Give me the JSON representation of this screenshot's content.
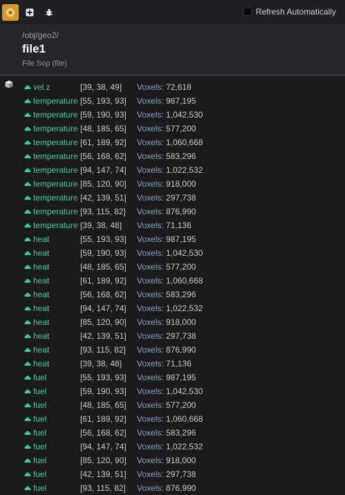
{
  "toolbar": {
    "refresh_label": "Refresh Automatically",
    "accent": "#d39a2f"
  },
  "header": {
    "path": "/obj/geo2/",
    "title": "file1",
    "subtitle": "File Sop (file)"
  },
  "volume_label": "Voxels:",
  "volumes": [
    {
      "name": "vel.z",
      "res": "[39, 38, 49]",
      "voxels": "72,618"
    },
    {
      "name": "temperature",
      "res": "[55, 193, 93]",
      "voxels": "987,195"
    },
    {
      "name": "temperature",
      "res": "[59, 190, 93]",
      "voxels": "1,042,530"
    },
    {
      "name": "temperature",
      "res": "[48, 185, 65]",
      "voxels": "577,200"
    },
    {
      "name": "temperature",
      "res": "[61, 189, 92]",
      "voxels": "1,060,668"
    },
    {
      "name": "temperature",
      "res": "[56, 168, 62]",
      "voxels": "583,296"
    },
    {
      "name": "temperature",
      "res": "[94, 147, 74]",
      "voxels": "1,022,532"
    },
    {
      "name": "temperature",
      "res": "[85, 120, 90]",
      "voxels": "918,000"
    },
    {
      "name": "temperature",
      "res": "[42, 139, 51]",
      "voxels": "297,738"
    },
    {
      "name": "temperature",
      "res": "[93, 115, 82]",
      "voxels": "876,990"
    },
    {
      "name": "temperature",
      "res": "[39, 38, 48]",
      "voxels": "71,136"
    },
    {
      "name": "heat",
      "res": "[55, 193, 93]",
      "voxels": "987,195"
    },
    {
      "name": "heat",
      "res": "[59, 190, 93]",
      "voxels": "1,042,530"
    },
    {
      "name": "heat",
      "res": "[48, 185, 65]",
      "voxels": "577,200"
    },
    {
      "name": "heat",
      "res": "[61, 189, 92]",
      "voxels": "1,060,668"
    },
    {
      "name": "heat",
      "res": "[56, 168, 62]",
      "voxels": "583,296"
    },
    {
      "name": "heat",
      "res": "[94, 147, 74]",
      "voxels": "1,022,532"
    },
    {
      "name": "heat",
      "res": "[85, 120, 90]",
      "voxels": "918,000"
    },
    {
      "name": "heat",
      "res": "[42, 139, 51]",
      "voxels": "297,738"
    },
    {
      "name": "heat",
      "res": "[93, 115, 82]",
      "voxels": "876,990"
    },
    {
      "name": "heat",
      "res": "[39, 38, 48]",
      "voxels": "71,136"
    },
    {
      "name": "fuel",
      "res": "[55, 193, 93]",
      "voxels": "987,195"
    },
    {
      "name": "fuel",
      "res": "[59, 190, 93]",
      "voxels": "1,042,530"
    },
    {
      "name": "fuel",
      "res": "[48, 185, 65]",
      "voxels": "577,200"
    },
    {
      "name": "fuel",
      "res": "[61, 189, 92]",
      "voxels": "1,060,668"
    },
    {
      "name": "fuel",
      "res": "[56, 168, 62]",
      "voxels": "583,296"
    },
    {
      "name": "fuel",
      "res": "[94, 147, 74]",
      "voxels": "1,022,532"
    },
    {
      "name": "fuel",
      "res": "[85, 120, 90]",
      "voxels": "918,000"
    },
    {
      "name": "fuel",
      "res": "[42, 139, 51]",
      "voxels": "297,738"
    },
    {
      "name": "fuel",
      "res": "[93, 115, 82]",
      "voxels": "876,990"
    }
  ]
}
